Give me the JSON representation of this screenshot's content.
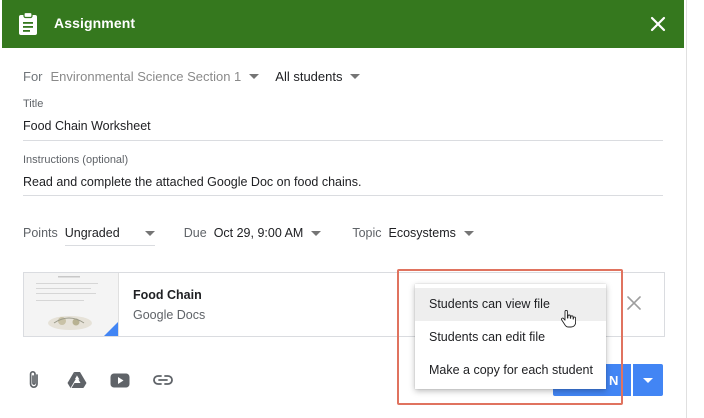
{
  "header": {
    "title": "Assignment",
    "bg_color": "#35781e"
  },
  "for_row": {
    "label": "For",
    "class_name": "Environmental Science Section 1",
    "students": "All students"
  },
  "title_field": {
    "label": "Title",
    "value": "Food Chain Worksheet"
  },
  "instructions_field": {
    "label": "Instructions (optional)",
    "value": "Read and complete the attached Google Doc on food chains."
  },
  "settings": {
    "points_label": "Points",
    "points_value": "Ungraded",
    "due_label": "Due",
    "due_value": "Oct 29, 9:00 AM",
    "topic_label": "Topic",
    "topic_value": "Ecosystems"
  },
  "attachment": {
    "title": "Food Chain",
    "subtitle": "Google Docs"
  },
  "share_menu": {
    "items": [
      "Students can view file",
      "Students can edit file",
      "Make a copy for each student"
    ],
    "hovered_index": 0
  },
  "assign_button": {
    "visible_label": "N",
    "color": "#4285f4"
  },
  "toolbar_icons": [
    "attach-icon",
    "drive-icon",
    "youtube-icon",
    "link-icon"
  ],
  "highlight_color": "#e0735f"
}
